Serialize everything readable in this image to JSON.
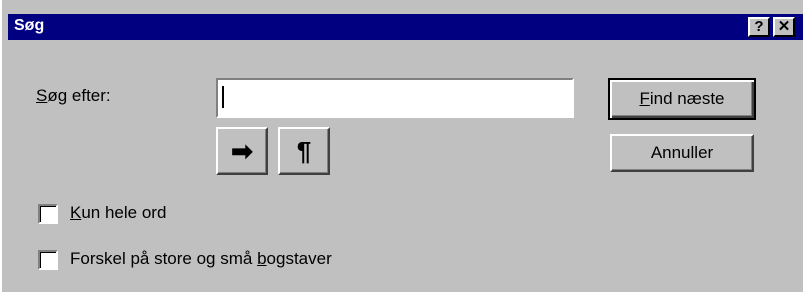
{
  "window": {
    "title": "Søg",
    "help_glyph": "?",
    "close_glyph": "✕"
  },
  "search": {
    "label_underlined": "S",
    "label_rest": "øg efter:",
    "value": ""
  },
  "buttons": {
    "find_next_underlined": "F",
    "find_next_rest": "ind næste",
    "cancel": "Annuller",
    "arrow_glyph": "➡",
    "pilcrow_glyph": "¶"
  },
  "options": {
    "whole_word_underlined": "K",
    "whole_word_rest": "un hele ord",
    "whole_word_checked": false,
    "match_case_before": "Forskel på store og små ",
    "match_case_underlined": "b",
    "match_case_after": "ogstaver",
    "match_case_checked": false
  },
  "colors": {
    "titlebar": "#000080",
    "face": "#c0c0c0"
  }
}
